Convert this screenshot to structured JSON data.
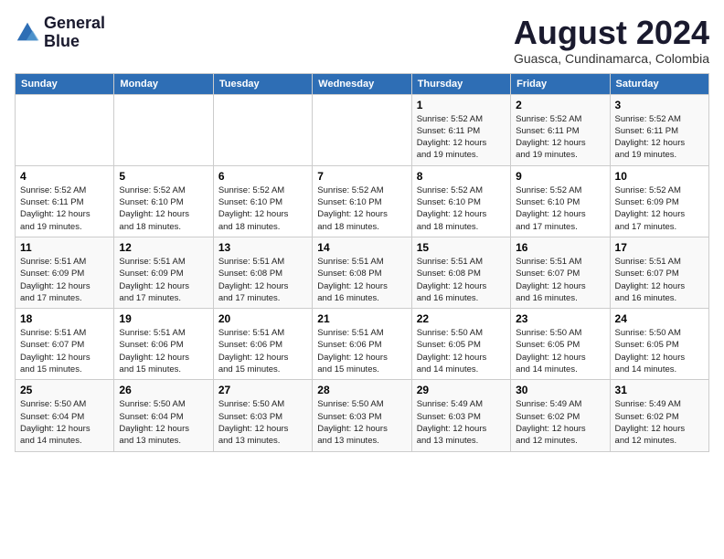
{
  "header": {
    "logo_line1": "General",
    "logo_line2": "Blue",
    "title": "August 2024",
    "subtitle": "Guasca, Cundinamarca, Colombia"
  },
  "days_of_week": [
    "Sunday",
    "Monday",
    "Tuesday",
    "Wednesday",
    "Thursday",
    "Friday",
    "Saturday"
  ],
  "weeks": [
    [
      {
        "day": "",
        "info": ""
      },
      {
        "day": "",
        "info": ""
      },
      {
        "day": "",
        "info": ""
      },
      {
        "day": "",
        "info": ""
      },
      {
        "day": "1",
        "info": "Sunrise: 5:52 AM\nSunset: 6:11 PM\nDaylight: 12 hours\nand 19 minutes."
      },
      {
        "day": "2",
        "info": "Sunrise: 5:52 AM\nSunset: 6:11 PM\nDaylight: 12 hours\nand 19 minutes."
      },
      {
        "day": "3",
        "info": "Sunrise: 5:52 AM\nSunset: 6:11 PM\nDaylight: 12 hours\nand 19 minutes."
      }
    ],
    [
      {
        "day": "4",
        "info": "Sunrise: 5:52 AM\nSunset: 6:11 PM\nDaylight: 12 hours\nand 19 minutes."
      },
      {
        "day": "5",
        "info": "Sunrise: 5:52 AM\nSunset: 6:10 PM\nDaylight: 12 hours\nand 18 minutes."
      },
      {
        "day": "6",
        "info": "Sunrise: 5:52 AM\nSunset: 6:10 PM\nDaylight: 12 hours\nand 18 minutes."
      },
      {
        "day": "7",
        "info": "Sunrise: 5:52 AM\nSunset: 6:10 PM\nDaylight: 12 hours\nand 18 minutes."
      },
      {
        "day": "8",
        "info": "Sunrise: 5:52 AM\nSunset: 6:10 PM\nDaylight: 12 hours\nand 18 minutes."
      },
      {
        "day": "9",
        "info": "Sunrise: 5:52 AM\nSunset: 6:10 PM\nDaylight: 12 hours\nand 17 minutes."
      },
      {
        "day": "10",
        "info": "Sunrise: 5:52 AM\nSunset: 6:09 PM\nDaylight: 12 hours\nand 17 minutes."
      }
    ],
    [
      {
        "day": "11",
        "info": "Sunrise: 5:51 AM\nSunset: 6:09 PM\nDaylight: 12 hours\nand 17 minutes."
      },
      {
        "day": "12",
        "info": "Sunrise: 5:51 AM\nSunset: 6:09 PM\nDaylight: 12 hours\nand 17 minutes."
      },
      {
        "day": "13",
        "info": "Sunrise: 5:51 AM\nSunset: 6:08 PM\nDaylight: 12 hours\nand 17 minutes."
      },
      {
        "day": "14",
        "info": "Sunrise: 5:51 AM\nSunset: 6:08 PM\nDaylight: 12 hours\nand 16 minutes."
      },
      {
        "day": "15",
        "info": "Sunrise: 5:51 AM\nSunset: 6:08 PM\nDaylight: 12 hours\nand 16 minutes."
      },
      {
        "day": "16",
        "info": "Sunrise: 5:51 AM\nSunset: 6:07 PM\nDaylight: 12 hours\nand 16 minutes."
      },
      {
        "day": "17",
        "info": "Sunrise: 5:51 AM\nSunset: 6:07 PM\nDaylight: 12 hours\nand 16 minutes."
      }
    ],
    [
      {
        "day": "18",
        "info": "Sunrise: 5:51 AM\nSunset: 6:07 PM\nDaylight: 12 hours\nand 15 minutes."
      },
      {
        "day": "19",
        "info": "Sunrise: 5:51 AM\nSunset: 6:06 PM\nDaylight: 12 hours\nand 15 minutes."
      },
      {
        "day": "20",
        "info": "Sunrise: 5:51 AM\nSunset: 6:06 PM\nDaylight: 12 hours\nand 15 minutes."
      },
      {
        "day": "21",
        "info": "Sunrise: 5:51 AM\nSunset: 6:06 PM\nDaylight: 12 hours\nand 15 minutes."
      },
      {
        "day": "22",
        "info": "Sunrise: 5:50 AM\nSunset: 6:05 PM\nDaylight: 12 hours\nand 14 minutes."
      },
      {
        "day": "23",
        "info": "Sunrise: 5:50 AM\nSunset: 6:05 PM\nDaylight: 12 hours\nand 14 minutes."
      },
      {
        "day": "24",
        "info": "Sunrise: 5:50 AM\nSunset: 6:05 PM\nDaylight: 12 hours\nand 14 minutes."
      }
    ],
    [
      {
        "day": "25",
        "info": "Sunrise: 5:50 AM\nSunset: 6:04 PM\nDaylight: 12 hours\nand 14 minutes."
      },
      {
        "day": "26",
        "info": "Sunrise: 5:50 AM\nSunset: 6:04 PM\nDaylight: 12 hours\nand 13 minutes."
      },
      {
        "day": "27",
        "info": "Sunrise: 5:50 AM\nSunset: 6:03 PM\nDaylight: 12 hours\nand 13 minutes."
      },
      {
        "day": "28",
        "info": "Sunrise: 5:50 AM\nSunset: 6:03 PM\nDaylight: 12 hours\nand 13 minutes."
      },
      {
        "day": "29",
        "info": "Sunrise: 5:49 AM\nSunset: 6:03 PM\nDaylight: 12 hours\nand 13 minutes."
      },
      {
        "day": "30",
        "info": "Sunrise: 5:49 AM\nSunset: 6:02 PM\nDaylight: 12 hours\nand 12 minutes."
      },
      {
        "day": "31",
        "info": "Sunrise: 5:49 AM\nSunset: 6:02 PM\nDaylight: 12 hours\nand 12 minutes."
      }
    ]
  ]
}
